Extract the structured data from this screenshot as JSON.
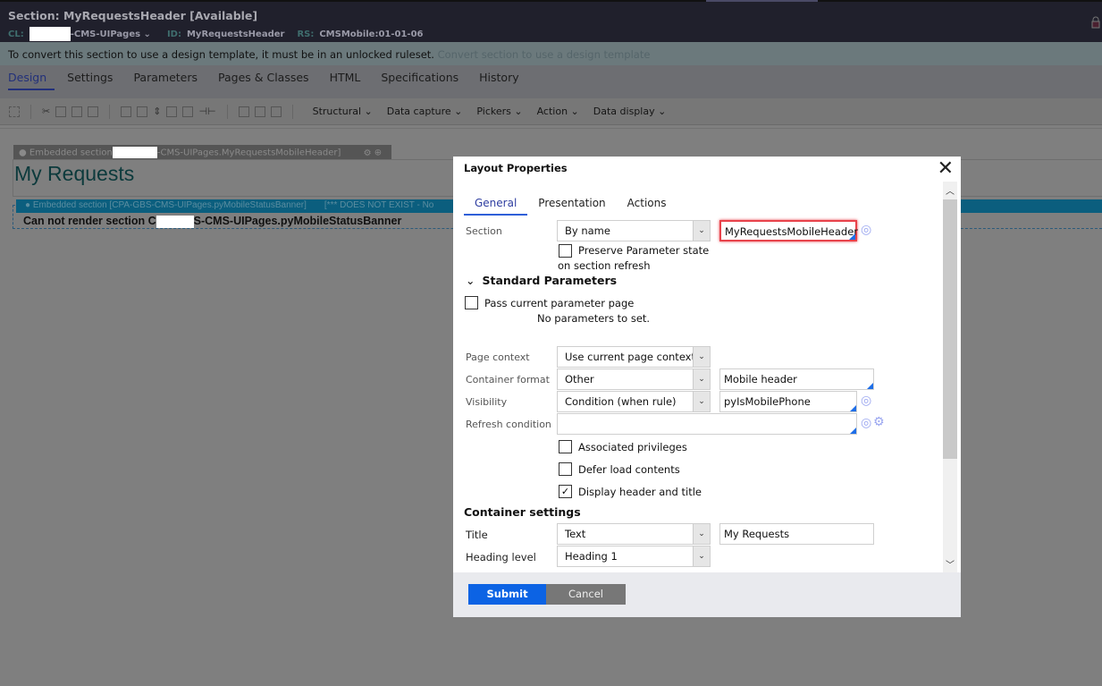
{
  "header": {
    "title": "Section: MyRequestsHeader [Available]",
    "cl_label": "CL:",
    "cl_value": "-CMS-UIPages",
    "id_label": "ID:",
    "id_value": "MyRequestsHeader",
    "rs_label": "RS:",
    "rs_value": "CMSMobile:01-01-06"
  },
  "banner": {
    "text": "To convert this section to use a design template, it must be in an unlocked ruleset.",
    "link": "Convert section to use a design template"
  },
  "tabs": [
    "Design",
    "Settings",
    "Parameters",
    "Pages & Classes",
    "HTML",
    "Specifications",
    "History"
  ],
  "toolbar": {
    "menus": [
      "Structural",
      "Data capture",
      "Pickers",
      "Action",
      "Data display"
    ]
  },
  "canvas": {
    "embedded1_prefix": "Embedded section",
    "embedded1_suffix": "-CMS-UIPages.MyRequestsMobileHeader]",
    "heading": "My Requests",
    "embedded2": "Embedded section [CPA-GBS-CMS-UIPages.pyMobileStatusBanner]",
    "embedded2_status": "[*** DOES NOT EXIST - No",
    "cannot_prefix": "Can not render section C",
    "cannot_suffix": "S-CMS-UIPages.pyMobileStatusBanner"
  },
  "modal": {
    "title": "Layout Properties",
    "tabs": [
      "General",
      "Presentation",
      "Actions"
    ],
    "section_label": "Section",
    "section_type": "By name",
    "section_name": "MyRequestsMobileHeader",
    "preserve_label": "Preserve Parameter state",
    "preserve_label2": "on section refresh",
    "std_params": "Standard Parameters",
    "pass_param": "Pass current parameter page",
    "no_params": "No parameters to set.",
    "page_context_label": "Page context",
    "page_context": "Use current page context",
    "container_format_label": "Container format",
    "container_format": "Other",
    "container_format_value": "Mobile header",
    "visibility_label": "Visibility",
    "visibility": "Condition (when rule)",
    "visibility_value": "pyIsMobilePhone",
    "refresh_label": "Refresh condition",
    "refresh_value": "",
    "assoc_priv": "Associated privileges",
    "defer_load": "Defer load contents",
    "display_header": "Display header and title",
    "display_header_checked": true,
    "container_settings": "Container settings",
    "title_label": "Title",
    "title_type": "Text",
    "title_value": "My Requests",
    "heading_label": "Heading level",
    "heading_value": "Heading 1",
    "submit": "Submit",
    "cancel": "Cancel"
  }
}
